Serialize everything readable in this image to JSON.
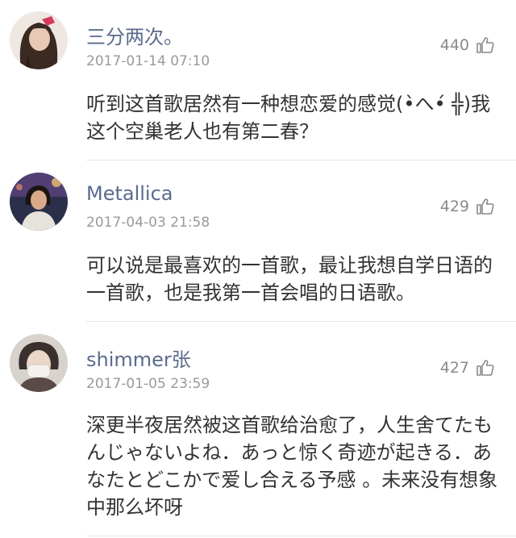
{
  "comments": [
    {
      "username": "三分两次。",
      "timestamp": "2017-01-14 07:10",
      "likes": "440",
      "text": "听到这首歌居然有一种想恋爱的感觉(•̀へ•́ ╬)我这个空巢老人也有第二春？",
      "avatar_icon": "girl-avatar",
      "avatar_colors": [
        "#3a2a22",
        "#e8c9b5",
        "#d43b5c"
      ]
    },
    {
      "username": "Metallica",
      "timestamp": "2017-04-03 21:58",
      "likes": "429",
      "text": "可以说是最喜欢的一首歌，最让我想自学日语的一首歌，也是我第一首会唱的日语歌。",
      "avatar_icon": "person-photo-avatar",
      "avatar_colors": [
        "#2b2f4a",
        "#d9a98a",
        "#6b4a8f"
      ]
    },
    {
      "username": "shimmer张",
      "timestamp": "2017-01-05 23:59",
      "likes": "427",
      "text": "深更半夜居然被这首歌给治愈了，人生舍てたもんじゃないよね．あっと惊く奇迹が起きる．あなたとどこかで爱し合える予感 。未来没有想象中那么坏呀",
      "avatar_icon": "masked-person-avatar",
      "avatar_colors": [
        "#d8d2cc",
        "#3a3030",
        "#f4f2f0"
      ]
    }
  ],
  "colors": {
    "username": "#5a6b8c",
    "timestamp": "#9a9a9a",
    "like": "#8a8a8a",
    "text": "#333333",
    "divider": "#e6e6e6"
  },
  "icons": {
    "like": "thumbs-up-icon"
  }
}
